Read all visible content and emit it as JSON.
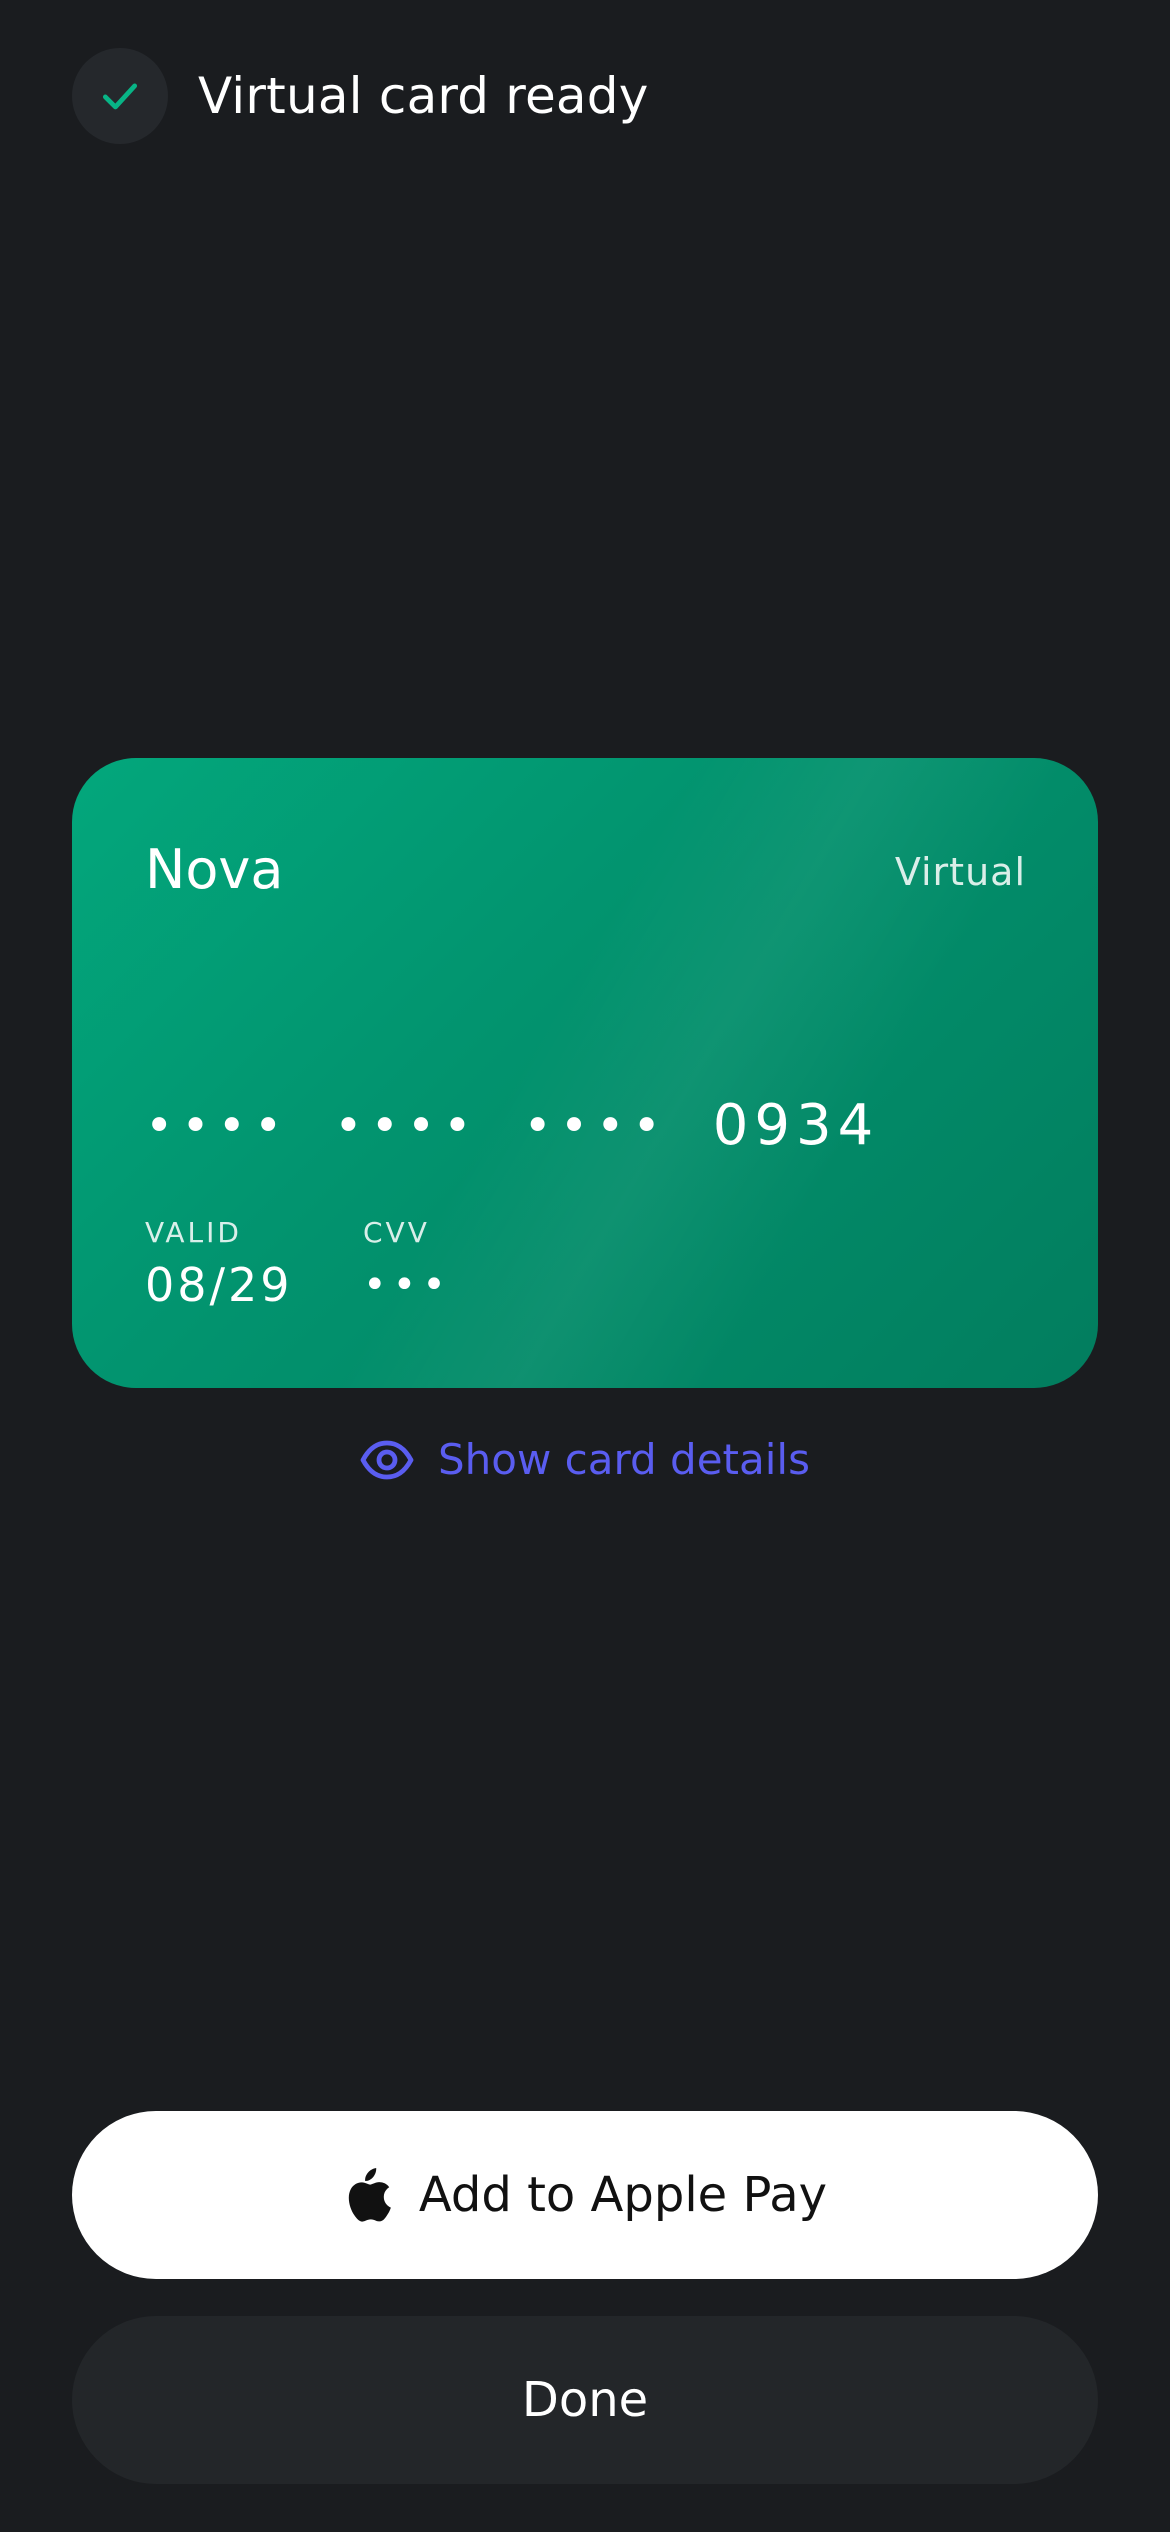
{
  "header": {
    "title": "Virtual card ready"
  },
  "card": {
    "brand": "Nova",
    "type": "Virtual",
    "number_masked_groups": [
      "••••",
      "••••",
      "••••"
    ],
    "last4": "0934",
    "valid_label": "VALID",
    "valid_value": "08/29",
    "cvv_label": "CVV",
    "cvv_value": "•••"
  },
  "links": {
    "show_details": "Show card details"
  },
  "buttons": {
    "apple_pay": "Add to Apple Pay",
    "done": "Done"
  },
  "colors": {
    "background": "#1a1c1f",
    "card_green": "#02946f",
    "check_green": "#08b486",
    "link": "#5a5df0"
  },
  "icons": {
    "status": "check-icon",
    "details": "eye-icon",
    "apple_pay": "apple-icon"
  }
}
